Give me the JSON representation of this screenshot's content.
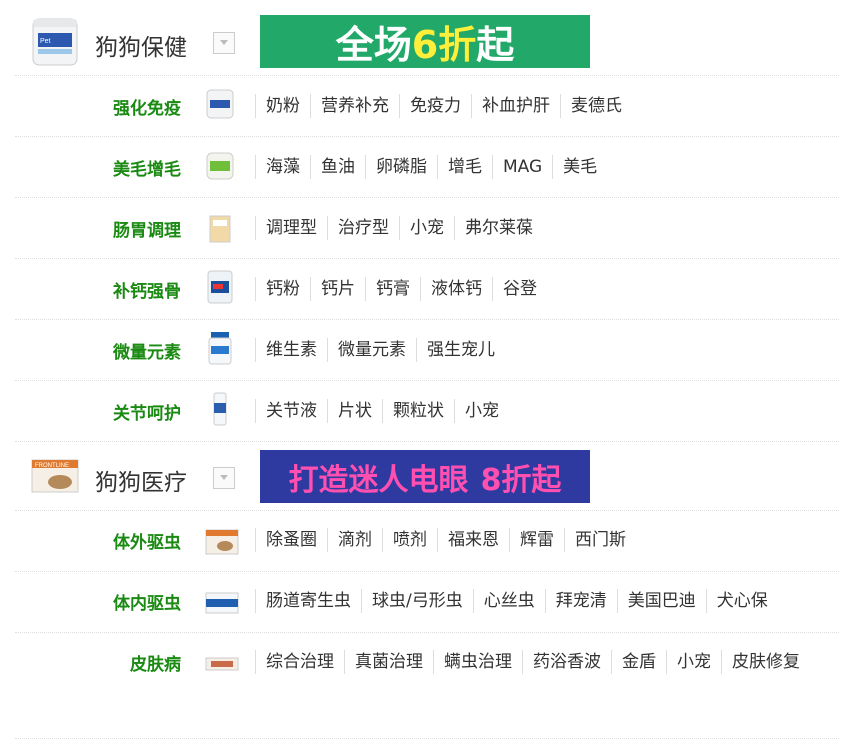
{
  "sections": [
    {
      "title": "狗狗保健",
      "banner": {
        "text_a": "全场",
        "text_b": "6折",
        "text_c": "起",
        "bg": "#22a868"
      },
      "rows": [
        {
          "category": "强化免疫",
          "links": [
            "奶粉",
            "营养补充",
            "免疫力",
            "补血护肝",
            "麦德氏"
          ]
        },
        {
          "category": "美毛增毛",
          "links": [
            "海藻",
            "鱼油",
            "卵磷脂",
            "增毛",
            "MAG",
            "美毛"
          ]
        },
        {
          "category": "肠胃调理",
          "links": [
            "调理型",
            "治疗型",
            "小宠",
            "弗尔莱葆"
          ]
        },
        {
          "category": "补钙强骨",
          "links": [
            "钙粉",
            "钙片",
            "钙膏",
            "液体钙",
            "谷登"
          ]
        },
        {
          "category": "微量元素",
          "links": [
            "维生素",
            "微量元素",
            "强生宠儿"
          ]
        },
        {
          "category": "关节呵护",
          "links": [
            "关节液",
            "片状",
            "颗粒状",
            "小宠"
          ]
        }
      ]
    },
    {
      "title": "狗狗医疗",
      "banner": {
        "text_a": "打造迷人电眼",
        "text_b": "8折起",
        "bg": "#2e3aa0"
      },
      "rows": [
        {
          "category": "体外驱虫",
          "links": [
            "除蚤圈",
            "滴剂",
            "喷剂",
            "福来恩",
            "辉雷",
            "西门斯"
          ]
        },
        {
          "category": "体内驱虫",
          "links": [
            "肠道寄生虫",
            "球虫/弓形虫",
            "心丝虫",
            "拜宠清",
            "美国巴迪",
            "犬心保"
          ]
        },
        {
          "category": "皮肤病",
          "links": [
            "综合治理",
            "真菌治理",
            "螨虫治理",
            "药浴香波",
            "金盾",
            "小宠",
            "皮肤修复"
          ]
        }
      ]
    }
  ]
}
